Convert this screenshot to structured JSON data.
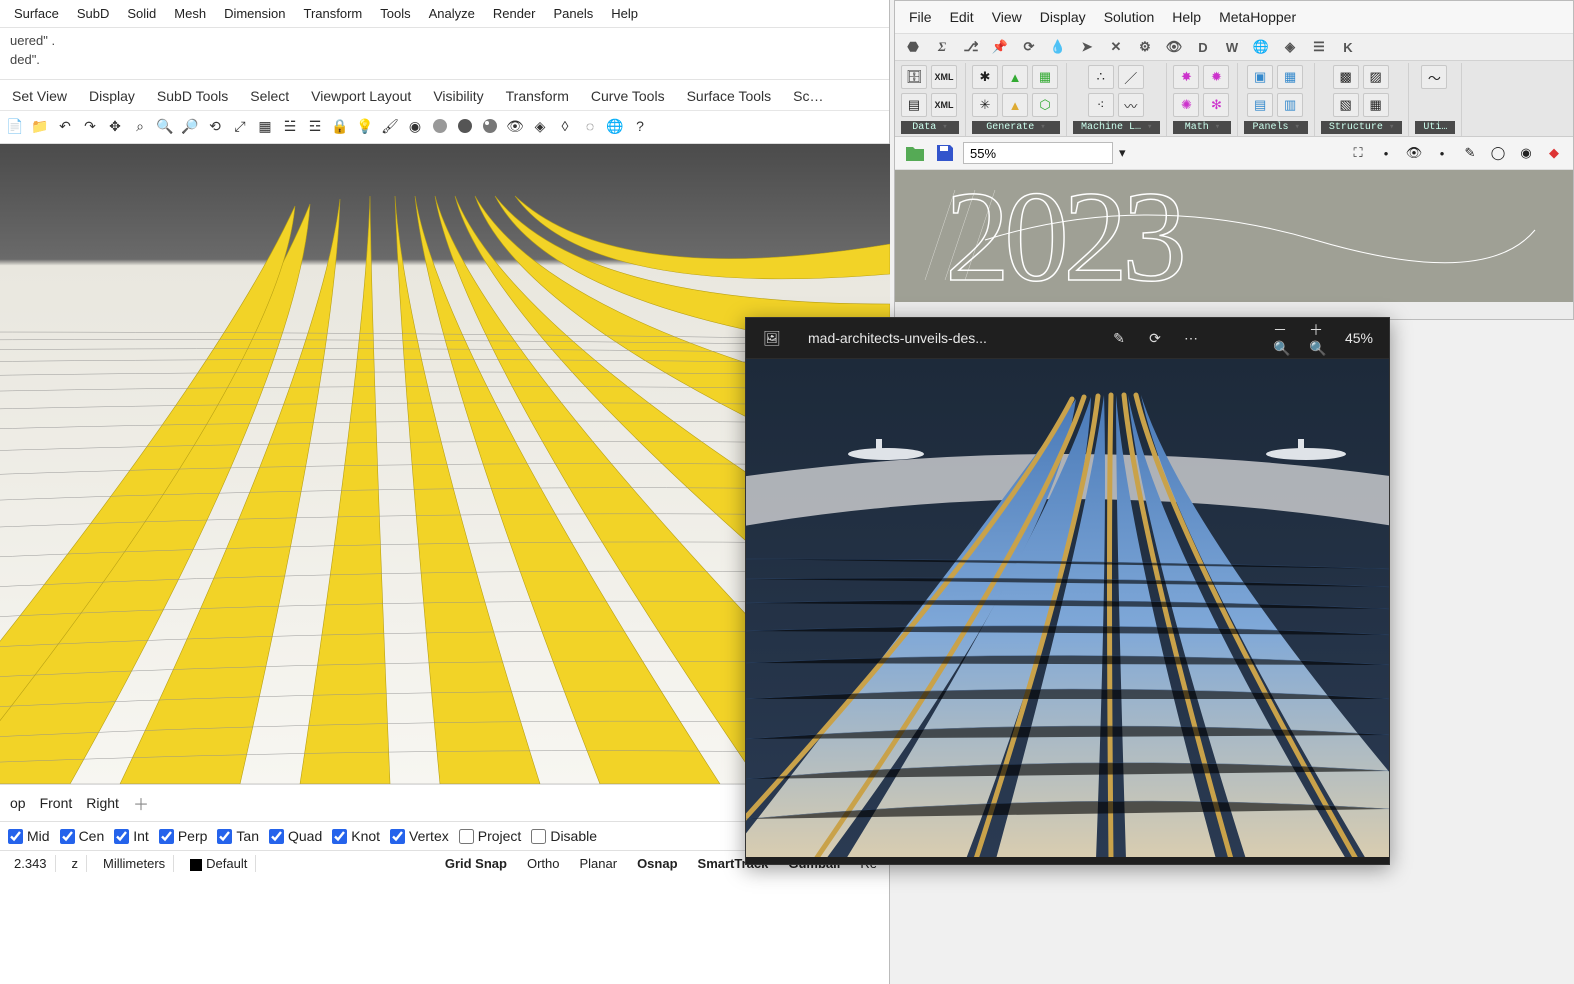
{
  "rhino": {
    "menu": [
      "Surface",
      "SubD",
      "Solid",
      "Mesh",
      "Dimension",
      "Transform",
      "Tools",
      "Analyze",
      "Render",
      "Panels",
      "Help"
    ],
    "cmd": {
      "l1": "uered\" .",
      "l2": "ded\"."
    },
    "tabs": [
      "Set View",
      "Display",
      "SubD Tools",
      "Select",
      "Viewport Layout",
      "Visibility",
      "Transform",
      "Curve Tools",
      "Surface Tools",
      "Sc…"
    ],
    "toolbar_icons": [
      "new",
      "open",
      "undo",
      "redo",
      "select-arrow",
      "zoom-extents",
      "zoom-window",
      "zoom-sel",
      "zoom-prev",
      "pan",
      "rotate",
      "grid",
      "layers-pop",
      "layers",
      "lock",
      "bulb",
      "paint",
      "materials",
      "sphere-gray",
      "sphere-dark",
      "sphere-hi",
      "hide",
      "show-sel",
      "show-all",
      "ghost",
      "render",
      "help"
    ],
    "vp_tabs": [
      "op",
      "Front",
      "Right"
    ],
    "osnaps": [
      {
        "label": "Mid",
        "on": true
      },
      {
        "label": "Cen",
        "on": true
      },
      {
        "label": "Int",
        "on": true
      },
      {
        "label": "Perp",
        "on": true
      },
      {
        "label": "Tan",
        "on": true
      },
      {
        "label": "Quad",
        "on": true
      },
      {
        "label": "Knot",
        "on": true
      },
      {
        "label": "Vertex",
        "on": true
      },
      {
        "label": "Project",
        "on": false
      },
      {
        "label": "Disable",
        "on": false
      }
    ],
    "status": {
      "coord": "2.343",
      "axis": "z",
      "units": "Millimeters",
      "layer": "Default",
      "btns": [
        {
          "t": "Grid Snap",
          "b": true
        },
        {
          "t": "Ortho",
          "b": false
        },
        {
          "t": "Planar",
          "b": false
        },
        {
          "t": "Osnap",
          "b": true
        },
        {
          "t": "SmartTrack",
          "b": true
        },
        {
          "t": "Gumball",
          "b": true
        },
        {
          "t": "Re",
          "b": false
        }
      ]
    }
  },
  "gh": {
    "menu": [
      "File",
      "Edit",
      "View",
      "Display",
      "Solution",
      "Help",
      "MetaHopper"
    ],
    "icon_letters": [
      "D",
      "W",
      "",
      "",
      "",
      "K"
    ],
    "ribbon": [
      {
        "name": "Data",
        "cols": 2,
        "icons": [
          "db",
          "xml",
          "grid",
          "xml2"
        ]
      },
      {
        "name": "Generate",
        "cols": 3,
        "icons": [
          "net",
          "tri",
          "sq",
          "net2",
          "tri2",
          "hex"
        ]
      },
      {
        "name": "Machine L…",
        "cols": 2,
        "icons": [
          "scat",
          "line",
          "scat2",
          "wave"
        ]
      },
      {
        "name": "Math",
        "cols": 2,
        "icons": [
          "star1",
          "star2",
          "star3",
          "star4"
        ]
      },
      {
        "name": "Panels",
        "cols": 2,
        "icons": [
          "rct",
          "grd",
          "rct2",
          "grd2"
        ]
      },
      {
        "name": "Structure",
        "cols": 2,
        "icons": [
          "mesh1",
          "mesh2",
          "mesh3",
          "mesh4"
        ]
      },
      {
        "name": "Uti…",
        "cols": 1,
        "icons": [
          "curve"
        ]
      }
    ],
    "zoom": "55%",
    "canvas_text": "2023"
  },
  "photos": {
    "title": "mad-architects-unveils-des...",
    "zoom": "45%"
  }
}
